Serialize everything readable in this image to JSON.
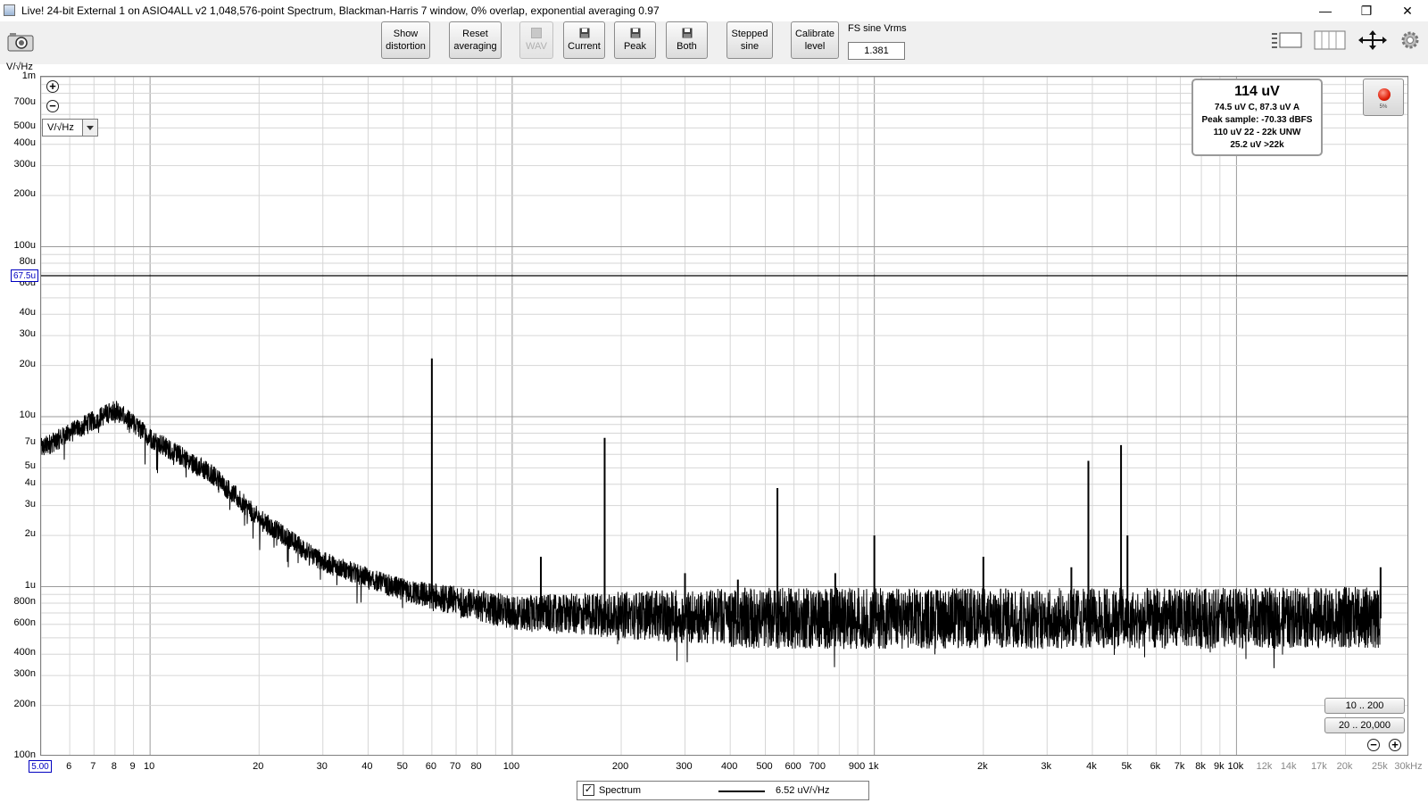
{
  "window": {
    "title": "Live! 24-bit External 1 on ASIO4ALL v2 1,048,576-point Spectrum, Blackman-Harris 7 window, 0% overlap, exponential averaging 0.97",
    "controls": [
      "—",
      "❐",
      "✕"
    ]
  },
  "toolbar": {
    "show_distortion": [
      "Show",
      "distortion"
    ],
    "reset_averaging": [
      "Reset",
      "averaging"
    ],
    "wav": "WAV",
    "current": "Current",
    "peak": "Peak",
    "both": "Both",
    "stepped_sine": [
      "Stepped",
      "sine"
    ],
    "calibrate_level": [
      "Calibrate",
      "level"
    ],
    "fs_label": "FS sine Vrms",
    "fs_value": "1.381"
  },
  "plot": {
    "units_label": "V/√Hz",
    "unit_select": "V/√Hz",
    "y_cursor": "67.5u",
    "x_cursor": "5.00"
  },
  "info": {
    "main": "114 uV",
    "line1": "74.5 uV C, 87.3 uV A",
    "line2": "Peak sample: -70.33 dBFS",
    "line3": "110 uV 22 - 22k UNW",
    "line4": "25.2 uV >22k"
  },
  "record": {
    "pct": "5%"
  },
  "range_buttons": {
    "r1": "10 .. 200",
    "r2": "20 .. 20,000"
  },
  "legend": {
    "checked": "✓",
    "name": "Spectrum",
    "value": "6.52 uV/√Hz"
  },
  "chart_data": {
    "type": "line",
    "xscale": "log",
    "yscale": "log",
    "xlim": [
      5,
      30000
    ],
    "ylim": [
      1e-07,
      0.001
    ],
    "ylabel": "V/√Hz",
    "yticks": [
      {
        "v": 0.001,
        "label": "1m"
      },
      {
        "v": 0.0007,
        "label": "700u"
      },
      {
        "v": 0.0005,
        "label": "500u"
      },
      {
        "v": 0.0004,
        "label": "400u"
      },
      {
        "v": 0.0003,
        "label": "300u"
      },
      {
        "v": 0.0002,
        "label": "200u"
      },
      {
        "v": 0.0001,
        "label": "100u"
      },
      {
        "v": 8e-05,
        "label": "80u"
      },
      {
        "v": 6e-05,
        "label": "60u"
      },
      {
        "v": 4e-05,
        "label": "40u"
      },
      {
        "v": 3e-05,
        "label": "30u"
      },
      {
        "v": 2e-05,
        "label": "20u"
      },
      {
        "v": 1e-05,
        "label": "10u"
      },
      {
        "v": 7e-06,
        "label": "7u"
      },
      {
        "v": 5e-06,
        "label": "5u"
      },
      {
        "v": 4e-06,
        "label": "4u"
      },
      {
        "v": 3e-06,
        "label": "3u"
      },
      {
        "v": 2e-06,
        "label": "2u"
      },
      {
        "v": 1e-06,
        "label": "1u"
      },
      {
        "v": 8e-07,
        "label": "800n"
      },
      {
        "v": 6e-07,
        "label": "600n"
      },
      {
        "v": 4e-07,
        "label": "400n"
      },
      {
        "v": 3e-07,
        "label": "300n"
      },
      {
        "v": 2e-07,
        "label": "200n"
      },
      {
        "v": 1e-07,
        "label": "100n"
      }
    ],
    "xticks": [
      {
        "v": 6,
        "label": "6"
      },
      {
        "v": 7,
        "label": "7"
      },
      {
        "v": 8,
        "label": "8"
      },
      {
        "v": 9,
        "label": "9"
      },
      {
        "v": 10,
        "label": "10"
      },
      {
        "v": 20,
        "label": "20"
      },
      {
        "v": 30,
        "label": "30"
      },
      {
        "v": 40,
        "label": "40"
      },
      {
        "v": 50,
        "label": "50"
      },
      {
        "v": 60,
        "label": "60"
      },
      {
        "v": 70,
        "label": "70"
      },
      {
        "v": 80,
        "label": "80"
      },
      {
        "v": 100,
        "label": "100"
      },
      {
        "v": 200,
        "label": "200"
      },
      {
        "v": 300,
        "label": "300"
      },
      {
        "v": 400,
        "label": "400"
      },
      {
        "v": 500,
        "label": "500"
      },
      {
        "v": 600,
        "label": "600"
      },
      {
        "v": 700,
        "label": "700"
      },
      {
        "v": 900,
        "label": "900"
      },
      {
        "v": 1000,
        "label": "1k"
      },
      {
        "v": 2000,
        "label": "2k"
      },
      {
        "v": 3000,
        "label": "3k"
      },
      {
        "v": 4000,
        "label": "4k"
      },
      {
        "v": 5000,
        "label": "5k"
      },
      {
        "v": 6000,
        "label": "6k"
      },
      {
        "v": 7000,
        "label": "7k"
      },
      {
        "v": 8000,
        "label": "8k"
      },
      {
        "v": 9000,
        "label": "9k"
      },
      {
        "v": 10000,
        "label": "10k"
      },
      {
        "v": 12000,
        "label": "12k"
      },
      {
        "v": 14000,
        "label": "14k"
      },
      {
        "v": 17000,
        "label": "17k"
      },
      {
        "v": 20000,
        "label": "20k"
      },
      {
        "v": 25000,
        "label": "25k"
      },
      {
        "v": 30000,
        "label": "30kHz"
      }
    ],
    "cursor_y": 6.75e-05,
    "series": [
      {
        "name": "Spectrum",
        "color": "#000000",
        "floor": [
          [
            5,
            6.5e-06
          ],
          [
            7,
            9.5e-06
          ],
          [
            8,
            1.1e-05
          ],
          [
            10,
            7.5e-06
          ],
          [
            15,
            4.5e-06
          ],
          [
            20,
            2.5e-06
          ],
          [
            30,
            1.4e-06
          ],
          [
            50,
            9.5e-07
          ],
          [
            80,
            7.8e-07
          ],
          [
            100,
            7e-07
          ],
          [
            200,
            6.8e-07
          ],
          [
            500,
            6.5e-07
          ],
          [
            1000,
            6.5e-07
          ],
          [
            3000,
            6.5e-07
          ],
          [
            10000,
            6.5e-07
          ],
          [
            20000,
            6.6e-07
          ],
          [
            25000,
            6.5e-07
          ]
        ],
        "peaks": [
          [
            60,
            2.2e-05
          ],
          [
            120,
            1.5e-06
          ],
          [
            180,
            7.5e-06
          ],
          [
            300,
            1.2e-06
          ],
          [
            420,
            1.1e-06
          ],
          [
            540,
            3.8e-06
          ],
          [
            780,
            1.2e-06
          ],
          [
            1000,
            2e-06
          ],
          [
            2000,
            1.5e-06
          ],
          [
            3500,
            1.3e-06
          ],
          [
            3900,
            5.5e-06
          ],
          [
            4800,
            6.8e-06
          ],
          [
            5000,
            2e-06
          ],
          [
            25000,
            1.3e-06
          ]
        ]
      }
    ]
  }
}
